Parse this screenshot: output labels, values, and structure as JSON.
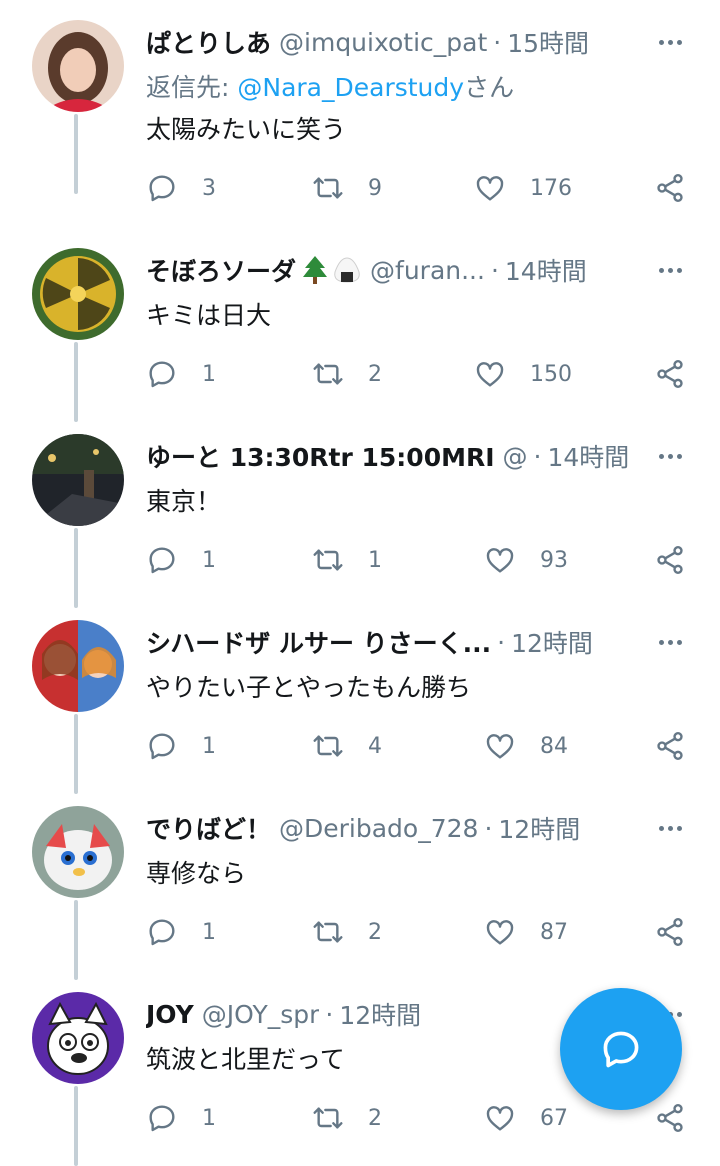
{
  "tweets": [
    {
      "name": "ぱとりしあ",
      "emojis": [],
      "handle": "@imquixotic_pat",
      "time": "15時間",
      "reply_prefix": "返信先: ",
      "reply_mention": "@Nara_Dearstudy",
      "reply_suffix": "さん",
      "text": "太陽みたいに笑う",
      "replies": "3",
      "retweets": "9",
      "likes": "176"
    },
    {
      "name": "そぼろソーダ",
      "emojis": [
        "tree-emoji",
        "onigiri-emoji"
      ],
      "handle": "@furan...",
      "time": "14時間",
      "text": "キミは日大",
      "replies": "1",
      "retweets": "2",
      "likes": "150"
    },
    {
      "name": "ゆーと 13:30Rtr 15:00MRI",
      "emojis": [],
      "handle": "@",
      "time": "14時間",
      "text": "東京！",
      "replies": "1",
      "retweets": "1",
      "likes": "93"
    },
    {
      "name": "シハードザ ルサー りさーく...",
      "emojis": [],
      "handle": "",
      "time": "12時間",
      "text": "やりたい子とやったもん勝ち",
      "replies": "1",
      "retweets": "4",
      "likes": "84"
    },
    {
      "name": "でりばど！",
      "emojis": [],
      "handle": "@Deribado_728",
      "time": "12時間",
      "text": "専修なら",
      "replies": "1",
      "retweets": "2",
      "likes": "87"
    },
    {
      "name": "JOY",
      "emojis": [],
      "handle": "@JOY_spr",
      "time": "12時間",
      "text": "筑波と北里だって",
      "replies": "1",
      "retweets": "2",
      "likes": "67"
    }
  ],
  "colors": {
    "accent": "#1da1f2",
    "text": "#14171a",
    "muted": "#657786",
    "thread": "#c4cfd6"
  },
  "fab": {
    "icon": "compose-reply-icon"
  }
}
